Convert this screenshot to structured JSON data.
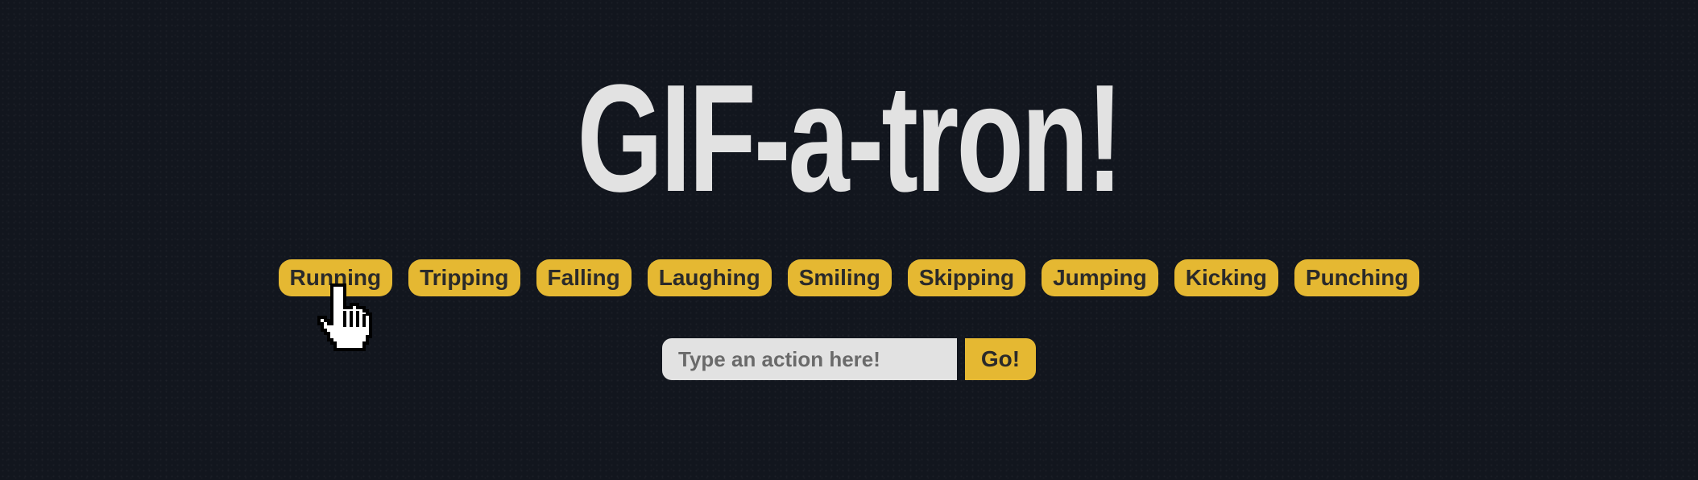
{
  "header": {
    "title": "GIF-a-tron!"
  },
  "actions": [
    {
      "label": "Running"
    },
    {
      "label": "Tripping"
    },
    {
      "label": "Falling"
    },
    {
      "label": "Laughing"
    },
    {
      "label": "Smiling"
    },
    {
      "label": "Skipping"
    },
    {
      "label": "Jumping"
    },
    {
      "label": "Kicking"
    },
    {
      "label": "Punching"
    }
  ],
  "search": {
    "placeholder": "Type an action here!",
    "value": "",
    "submit_label": "Go!"
  },
  "cursor": {
    "icon": "pointer-hand-icon"
  },
  "colors": {
    "background": "#12161e",
    "accent": "#e5b832",
    "title": "#e2e2e2",
    "input_bg": "#e2e2e2",
    "chip_text": "#2a2a2a"
  }
}
